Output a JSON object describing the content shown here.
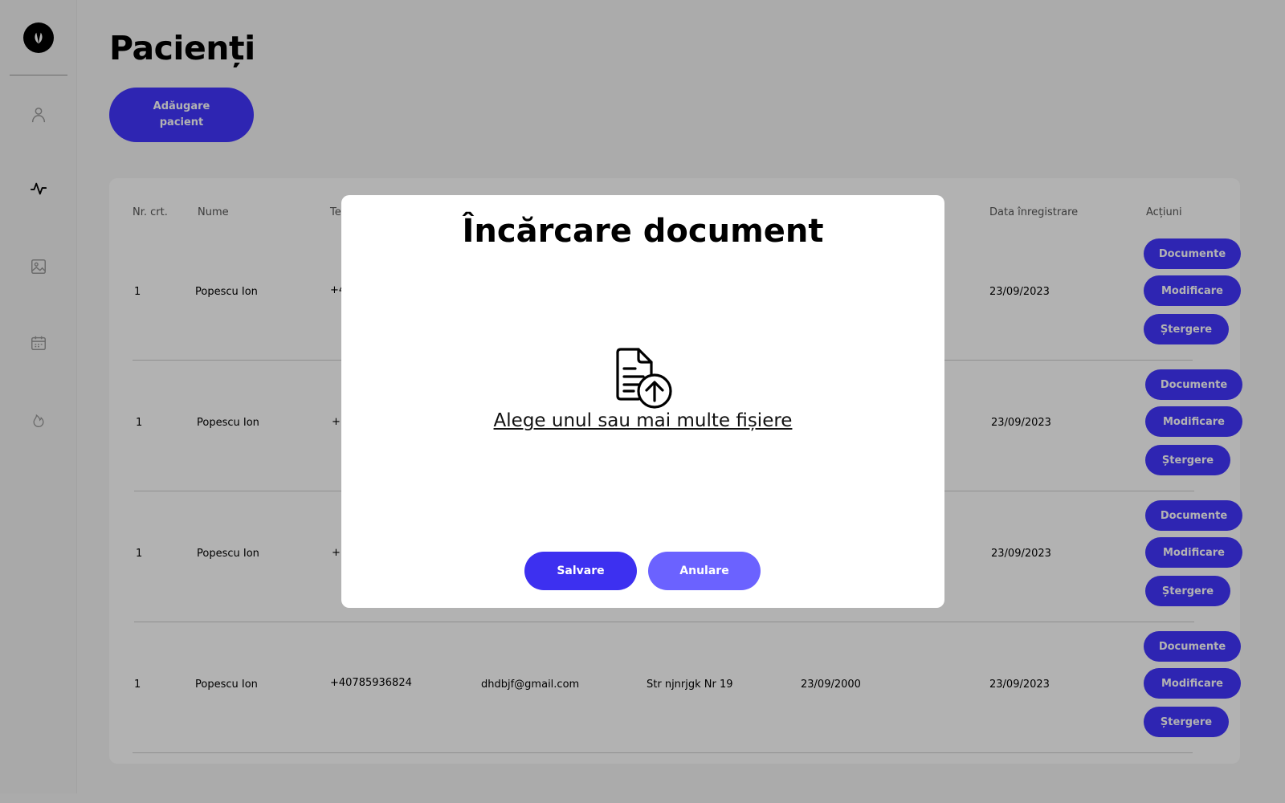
{
  "page": {
    "title": "Pacienți",
    "add_button": "Adăugare pacient"
  },
  "sidebar": {
    "logo": "leaf-logo",
    "items": [
      {
        "icon": "user-icon"
      },
      {
        "icon": "activity-icon",
        "active": true
      },
      {
        "icon": "image-icon"
      },
      {
        "icon": "calendar-icon"
      },
      {
        "icon": "flame-icon"
      }
    ]
  },
  "table": {
    "headers": [
      "Nr. crt.",
      "Nume",
      "Te",
      "Data înregistrare",
      "Acțiuni"
    ],
    "rows": [
      {
        "nr": "1",
        "name": "Popescu Ion",
        "phone": "+4",
        "email": "",
        "address": "",
        "birth": "",
        "reg": "23/09/2023"
      },
      {
        "nr": "1",
        "name": "Popescu Ion",
        "phone": "+",
        "email": "",
        "address": "",
        "birth": "",
        "reg": "23/09/2023"
      },
      {
        "nr": "1",
        "name": "Popescu Ion",
        "phone": "+",
        "email": "",
        "address": "",
        "birth": "",
        "reg": "23/09/2023"
      },
      {
        "nr": "1",
        "name": "Popescu Ion",
        "phone": "+40785936824",
        "email": "dhdbjf@gmail.com",
        "address": "Str njnrjgk Nr 19",
        "birth": "23/09/2000",
        "reg": "23/09/2023"
      }
    ],
    "actions": {
      "documents": "Documente",
      "edit": "Modificare",
      "delete": "Ștergere"
    }
  },
  "modal": {
    "title": "Încărcare document",
    "upload_icon": "file-upload-icon",
    "upload_link": "Alege unul sau mai multe fișiere",
    "save": "Salvare",
    "cancel": "Anulare"
  },
  "colors": {
    "accent": "#4235ff",
    "accent_light": "#6b62ff",
    "overlay": "rgba(0,0,0,0.30)"
  }
}
